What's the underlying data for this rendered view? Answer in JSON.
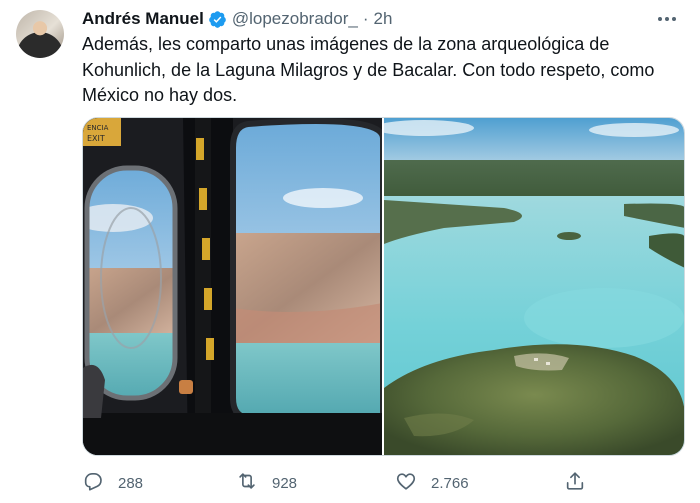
{
  "tweet": {
    "author_name": "Andrés Manuel",
    "handle": "@lopezobrador_",
    "separator": "·",
    "time": "2h",
    "text": "Además, les comparto unas imágenes de la zona arqueológica de Kohunlich, de la Laguna Milagros y de Bacalar. Con todo respeto, como México no hay dos.",
    "verified_color": "#1d9bf0"
  },
  "images": [
    {
      "subject": "airplane-window-view",
      "label_sign": "EMERGENCIA EXIT"
    },
    {
      "subject": "aerial-lagoon-view"
    }
  ],
  "actions": {
    "replies": "288",
    "retweets": "928",
    "likes": "2.766"
  },
  "icons": [
    "verified-icon",
    "more-icon",
    "reply-icon",
    "retweet-icon",
    "like-icon",
    "share-icon"
  ]
}
